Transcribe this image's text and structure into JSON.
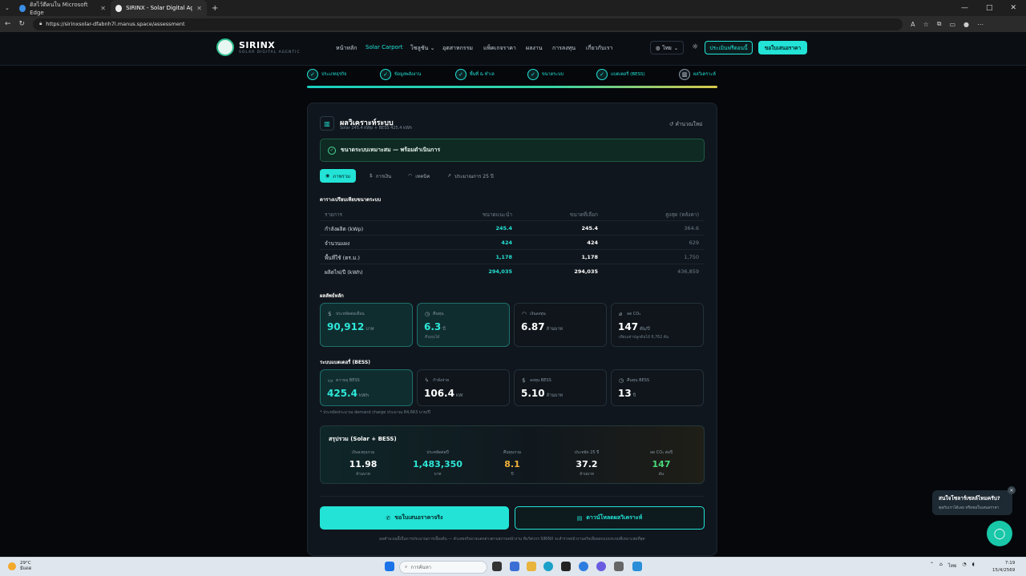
{
  "browser": {
    "tabs": [
      {
        "label": "ดิสไว้ตีคนใน Microsoft Edge",
        "active": false
      },
      {
        "label": "SIRINX - Solar Digital Agentic Co...",
        "active": true
      }
    ],
    "url": "https://sirinxsolar-dfabnh7l.manus.space/assessment",
    "window_buttons": [
      "—",
      "□",
      "✕"
    ]
  },
  "site": {
    "brand": "SIRINX",
    "tagline": "SOLAR DIGITAL AGENTIC",
    "nav": [
      "หน้าหลัก",
      "Solar Carport",
      "โซลูชัน",
      "อุตสาหกรรม",
      "แพ็คเกจราคา",
      "ผลงาน",
      "การลงทุน",
      "เกี่ยวกับเรา"
    ],
    "lang": "ไทย",
    "btn_eval": "ประเมินฟรีตอนนี้",
    "btn_quote": "ขอใบเสนอราคา"
  },
  "steps": [
    "ประเภทธุรกิจ",
    "ข้อมูลพลังงาน",
    "พื้นที่ & ทำเล",
    "ขนาดระบบ",
    "แบตเตอรี่ (BESS)",
    "ผลวิเคราะห์"
  ],
  "card": {
    "title": "ผลวิเคราะห์ระบบ",
    "subtitle": "Solar 245.4 kWp + BESS 425.4 kWh",
    "recalc": "คำนวณใหม่",
    "banner": "ขนาดระบบเหมาะสม — พร้อมดำเนินการ",
    "tabs": [
      "ภาพรวม",
      "การเงิน",
      "เทคนิค",
      "ประมาณการ 25 ปี"
    ],
    "table_title": "ตารางเปรียบเทียบขนาดระบบ",
    "table_head": [
      "รายการ",
      "ขนาดแนะนำ",
      "ขนาดที่เลือก",
      "สูงสุด (หลังคา)"
    ],
    "table_rows": [
      [
        "กำลังผลิต (kWp)",
        "245.4",
        "245.4",
        "364.6"
      ],
      [
        "จำนวนแผง",
        "424",
        "424",
        "629"
      ],
      [
        "พื้นที่ใช้ (ตร.ม.)",
        "1,178",
        "1,178",
        "1,750"
      ],
      [
        "ผลิตไฟ/ปี (kWh)",
        "294,035",
        "294,035",
        "436,859"
      ]
    ],
    "main_results_title": "ผลลัพธ์หลัก",
    "kpis": [
      {
        "icon": "$",
        "label": "ประหยัดต่อเดือน",
        "value": "90,912",
        "unit": "บาท",
        "note": ""
      },
      {
        "icon": "◷",
        "label": "คืนทุน",
        "value": "6.3",
        "unit": "ปี",
        "note": "คืนทุนได้"
      },
      {
        "icon": "◠",
        "label": "เงินลงทุน",
        "value": "6.87",
        "unit": "ล้านบาท",
        "note": ""
      },
      {
        "icon": "⌀",
        "label": "ลด CO₂",
        "value": "147",
        "unit": "ตัน/ปี",
        "note": "เทียบเท่าปลูกต้นไม้ 6,762 ต้น"
      }
    ],
    "bess_title": "ระบบแบตเตอรี่ (BESS)",
    "bess": [
      {
        "icon": "▭",
        "label": "ความจุ BESS",
        "value": "425.4",
        "unit": "kWh"
      },
      {
        "icon": "ϟ",
        "label": "กำลังจ่าย",
        "value": "106.4",
        "unit": "kW"
      },
      {
        "icon": "$",
        "label": "ลงทุน BESS",
        "value": "5.10",
        "unit": "ล้านบาท"
      },
      {
        "icon": "◷",
        "label": "คืนทุน BESS",
        "value": "13",
        "unit": "ปี"
      }
    ],
    "footnote": "* ประหยัดประมาณ demand charge ประมาณ 84,663 บาท/ปี",
    "summary_title": "สรุปรวม (Solar + BESS)",
    "summary": [
      {
        "label": "เงินลงทุนรวม",
        "value": "11.98",
        "unit": "ล้านบาท",
        "color": "#ffffff"
      },
      {
        "label": "ประหยัดต่อปี",
        "value": "1,483,350",
        "unit": "บาท",
        "color": "#2ee6d8"
      },
      {
        "label": "คืนทุนรวม",
        "value": "8.1",
        "unit": "ปี",
        "color": "#f2b13b"
      },
      {
        "label": "ประหยัด 25 ปี",
        "value": "37.2",
        "unit": "ล้านบาท",
        "color": "#ffffff"
      },
      {
        "label": "ลด CO₂ ต่อปี",
        "value": "147",
        "unit": "ตัน",
        "color": "#4ad97a"
      }
    ],
    "cta_primary": "ขอใบเสนอราคาจริง",
    "cta_secondary": "ดาวน์โหลดผลวิเคราะห์",
    "disclaimer": "ผลคำนวณนี้เป็นการประมาณการเบื้องต้น — ตัวเลขจริงอาจแตกต่างตามสภาพหน้างาน ทีมวิศวกร SIRINX จะสำรวจหน้างานจริงเพื่อออกแบบระบบที่เหมาะสมที่สุด"
  },
  "chat": {
    "title": "สนใจโซลาร์เซลล์ไหมครับ?",
    "sub": "คุยกับเราได้เลย หรือขอใบเสนอราคา"
  },
  "taskbar": {
    "temp": "29°C",
    "weather": "มีแดด",
    "search": "การค้นหา",
    "lang": "ไทย",
    "time": "7:19",
    "date": "15/4/2569"
  }
}
